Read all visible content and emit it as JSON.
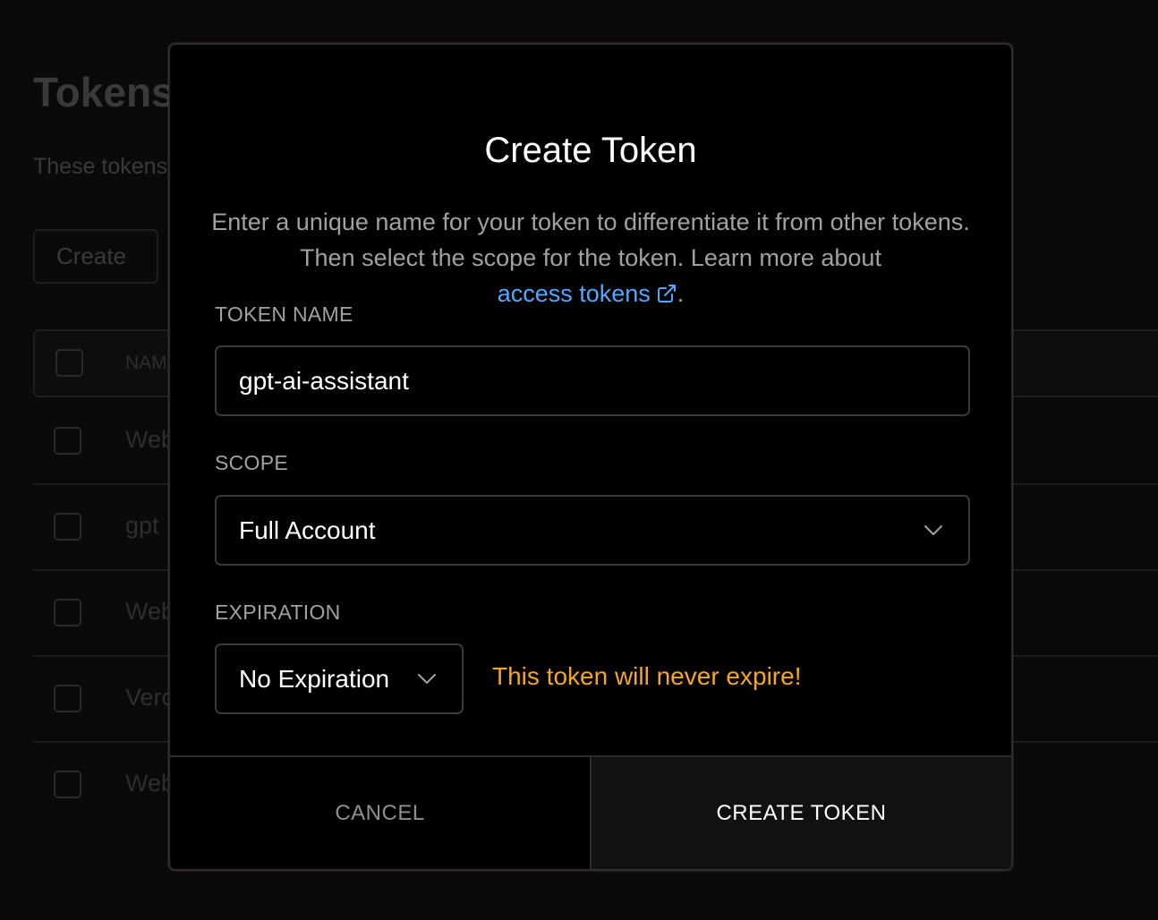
{
  "background": {
    "title": "Tokens",
    "description": "These tokens",
    "create_button": "Create",
    "table": {
      "name_header": "NAME",
      "rows": [
        "Web",
        "gpt",
        "Web",
        "Verc",
        "Web"
      ]
    }
  },
  "modal": {
    "title": "Create Token",
    "description": "Enter a unique name for your token to differentiate it from other tokens. Then select the scope for the token. Learn more about",
    "link_text": "access tokens",
    "link_suffix": ".",
    "token_name": {
      "label": "TOKEN NAME",
      "value": "gpt-ai-assistant"
    },
    "scope": {
      "label": "SCOPE",
      "selected": "Full Account"
    },
    "expiration": {
      "label": "EXPIRATION",
      "selected": "No Expiration",
      "warning": "This token will never expire!"
    },
    "footer": {
      "cancel_label": "CANCEL",
      "create_label": "CREATE TOKEN"
    }
  },
  "colors": {
    "link": "#52a8ff",
    "warning": "#f5a623",
    "modal_bg": "#000000",
    "page_bg": "#0a0a0a"
  }
}
